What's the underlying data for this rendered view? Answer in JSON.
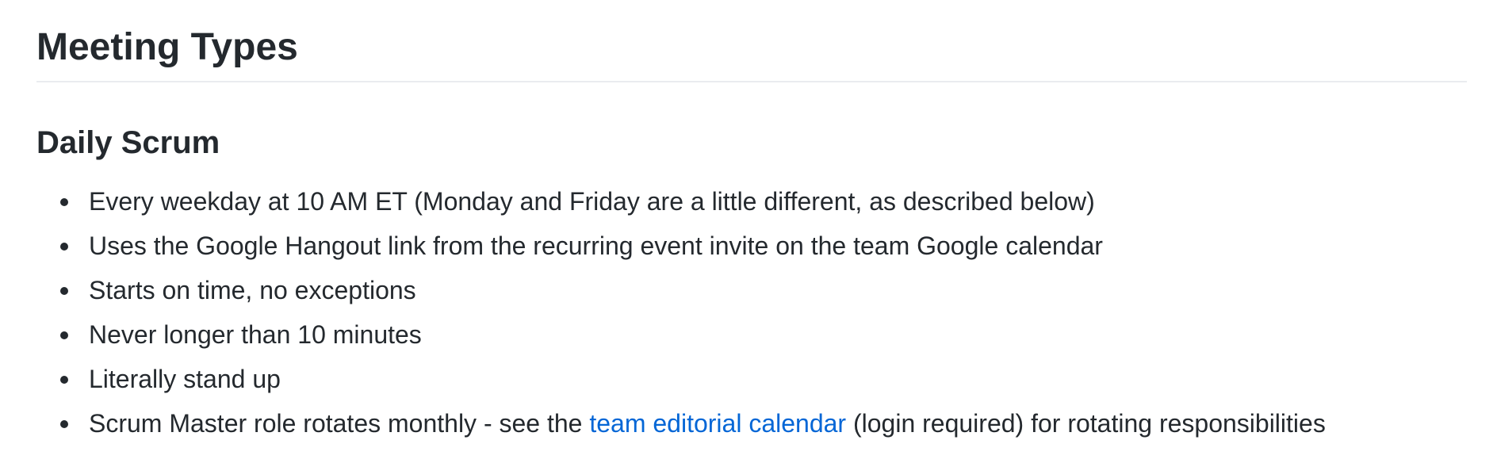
{
  "page_title": "Meeting Types",
  "section": {
    "title": "Daily Scrum",
    "items": [
      {
        "text": "Every weekday at 10 AM ET (Monday and Friday are a little different, as described below)"
      },
      {
        "text": "Uses the Google Hangout link from the recurring event invite on the team Google calendar"
      },
      {
        "text": "Starts on time, no exceptions"
      },
      {
        "text": "Never longer than 10 minutes"
      },
      {
        "text": "Literally stand up"
      },
      {
        "prefix": "Scrum Master role rotates monthly - see the ",
        "link": "team editorial calendar",
        "suffix": " (login required) for rotating responsibilities"
      }
    ]
  },
  "colors": {
    "text": "#24292e",
    "link": "#0366d6",
    "divider": "#eaecef"
  }
}
